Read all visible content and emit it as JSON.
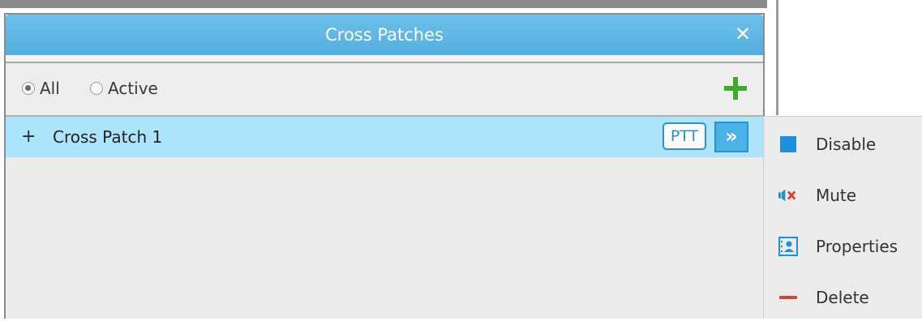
{
  "window": {
    "title": "Cross Patches",
    "close_glyph": "✕"
  },
  "filter": {
    "options": [
      {
        "label": "All",
        "selected": true
      },
      {
        "label": "Active",
        "selected": false
      }
    ],
    "add_icon": "plus-icon"
  },
  "list": {
    "rows": [
      {
        "expand_glyph": "+",
        "label": "Cross Patch 1",
        "selected": true,
        "ptt_label": "PTT",
        "more_glyph": "»"
      }
    ]
  },
  "context_menu": {
    "items": [
      {
        "label": "Disable",
        "icon": "square-icon"
      },
      {
        "label": "Mute",
        "icon": "speaker-mute-icon"
      },
      {
        "label": "Properties",
        "icon": "contact-card-icon"
      },
      {
        "label": "Delete",
        "icon": "minus-icon"
      }
    ]
  },
  "colors": {
    "title_bar": "#53aedf",
    "selection": "#ace4fb",
    "accent_blue": "#2b8fd0",
    "add_green": "#3faa2e",
    "mute_red": "#e03a2a",
    "delete_red": "#d9452f"
  }
}
